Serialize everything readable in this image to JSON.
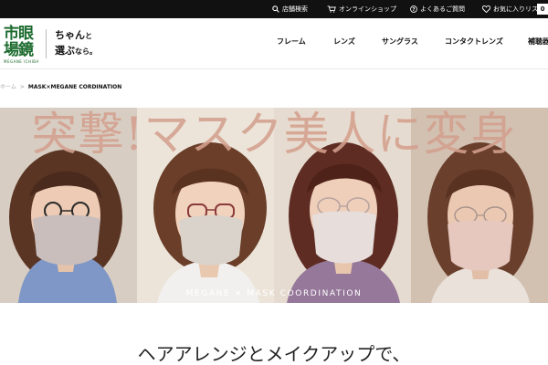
{
  "topbar": {
    "store_search": "店舗検索",
    "online_shop": "オンラインショップ",
    "faq": "よくあるご質問",
    "favorites": "お気に入りリスト",
    "cart_count": "0"
  },
  "header": {
    "logo_kanji_line1": "市眼",
    "logo_kanji_line2": "場鏡",
    "logo_roman": "MEGANE ICHIBA",
    "tagline_line1a": "ちゃん",
    "tagline_line1b": "と",
    "tagline_line2a": "選ぶ",
    "tagline_line2b": "なら。",
    "nav": [
      "フレーム",
      "レンズ",
      "サングラス",
      "コンタクトレンズ",
      "補聴器"
    ]
  },
  "breadcrumb": {
    "home": "ホーム",
    "separator": ">",
    "current": "MASK×MEGANE CORDINATION"
  },
  "hero": {
    "title": "突撃!マスク美人に変身",
    "caption": "MEGANE × MASK COORDINATION"
  },
  "headline": "ヘアアレンジとメイクアップで、"
}
